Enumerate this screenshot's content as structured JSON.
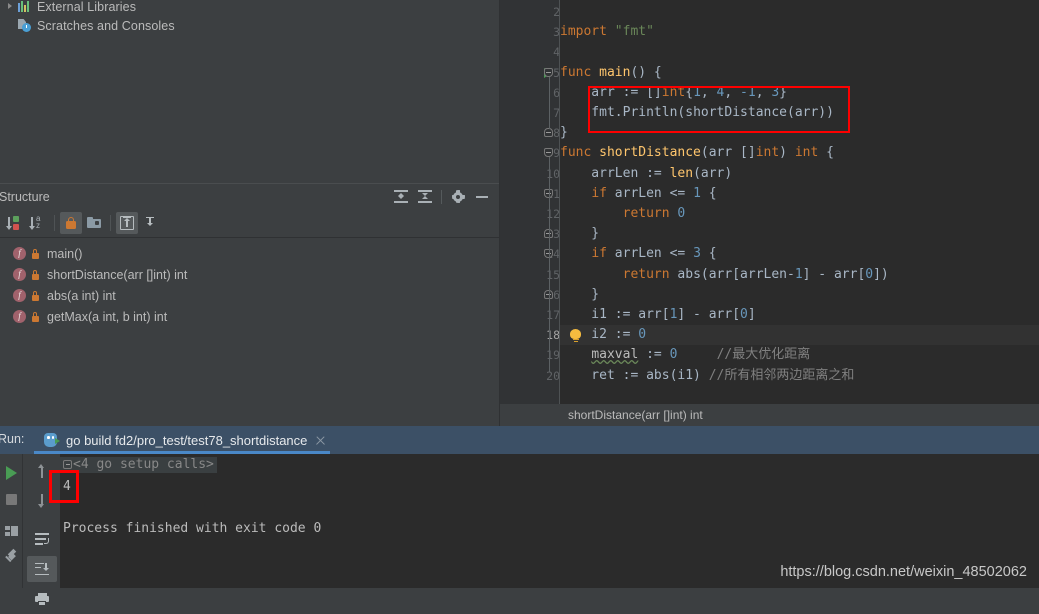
{
  "project_tree": {
    "items": [
      {
        "label": "External Libraries",
        "icon": "library-bars-icon",
        "expandable": true
      },
      {
        "label": "Scratches and Consoles",
        "icon": "scratches-icon",
        "expandable": false
      }
    ]
  },
  "structure": {
    "title": "Structure",
    "header_actions": [
      {
        "name": "expand-all-icon",
        "title": "Expand All"
      },
      {
        "name": "collapse-all-icon",
        "title": "Collapse All"
      },
      {
        "name": "gear-icon",
        "title": "Settings"
      },
      {
        "name": "minimize-icon",
        "title": "Hide"
      }
    ],
    "toolbar": [
      {
        "name": "sort-by-visibility-icon",
        "active": false
      },
      {
        "name": "sort-alphabetically-icon",
        "active": false
      },
      {
        "name": "show-non-public-icon",
        "active": true
      },
      {
        "name": "group-by-folder-icon",
        "active": false
      },
      {
        "name": "scroll-from-source-icon",
        "active": true
      },
      {
        "name": "scroll-to-source-icon",
        "active": false
      }
    ],
    "items": [
      {
        "label": "main()"
      },
      {
        "label": "shortDistance(arr []int) int"
      },
      {
        "label": "abs(a int) int"
      },
      {
        "label": "getMax(a int, b int) int"
      }
    ]
  },
  "editor": {
    "first_visible_line": 2,
    "current_line": 18,
    "run_marker_line": 5,
    "bulb_line": 18,
    "lines": [
      {
        "num": 2,
        "tokens": []
      },
      {
        "num": 3,
        "tokens": [
          {
            "t": "k",
            "v": "import"
          },
          {
            "t": "t",
            "v": " "
          },
          {
            "t": "s",
            "v": "\"fmt\""
          }
        ]
      },
      {
        "num": 4,
        "tokens": []
      },
      {
        "num": 5,
        "tokens": [
          {
            "t": "k",
            "v": "func"
          },
          {
            "t": "t",
            "v": " "
          },
          {
            "t": "f",
            "v": "main"
          },
          {
            "t": "t",
            "v": "() {"
          }
        ]
      },
      {
        "num": 6,
        "tokens": [
          {
            "t": "t",
            "v": "    arr := []"
          },
          {
            "t": "k",
            "v": "int"
          },
          {
            "t": "t",
            "v": "{"
          },
          {
            "t": "n",
            "v": "1"
          },
          {
            "t": "t",
            "v": ", "
          },
          {
            "t": "n",
            "v": "4"
          },
          {
            "t": "t",
            "v": ", "
          },
          {
            "t": "n",
            "v": "-1"
          },
          {
            "t": "t",
            "v": ", "
          },
          {
            "t": "n",
            "v": "3"
          },
          {
            "t": "t",
            "v": "}"
          }
        ]
      },
      {
        "num": 7,
        "tokens": [
          {
            "t": "t",
            "v": "    fmt."
          },
          {
            "t": "fn",
            "v": "Println"
          },
          {
            "t": "t",
            "v": "("
          },
          {
            "t": "fn",
            "v": "shortDistance"
          },
          {
            "t": "t",
            "v": "(arr))"
          }
        ]
      },
      {
        "num": 8,
        "tokens": [
          {
            "t": "t",
            "v": "}"
          }
        ]
      },
      {
        "num": 9,
        "tokens": [
          {
            "t": "k",
            "v": "func"
          },
          {
            "t": "t",
            "v": " "
          },
          {
            "t": "f",
            "v": "shortDistance"
          },
          {
            "t": "t",
            "v": "(arr []"
          },
          {
            "t": "k",
            "v": "int"
          },
          {
            "t": "t",
            "v": ") "
          },
          {
            "t": "k",
            "v": "int"
          },
          {
            "t": "t",
            "v": " {"
          }
        ]
      },
      {
        "num": 10,
        "tokens": [
          {
            "t": "t",
            "v": "    arrLen := "
          },
          {
            "t": "f",
            "v": "len"
          },
          {
            "t": "t",
            "v": "(arr)"
          }
        ]
      },
      {
        "num": 11,
        "tokens": [
          {
            "t": "t",
            "v": "    "
          },
          {
            "t": "k",
            "v": "if"
          },
          {
            "t": "t",
            "v": " arrLen <= "
          },
          {
            "t": "n",
            "v": "1"
          },
          {
            "t": "t",
            "v": " {"
          }
        ]
      },
      {
        "num": 12,
        "tokens": [
          {
            "t": "t",
            "v": "        "
          },
          {
            "t": "k",
            "v": "return"
          },
          {
            "t": "t",
            "v": " "
          },
          {
            "t": "n",
            "v": "0"
          }
        ]
      },
      {
        "num": 13,
        "tokens": [
          {
            "t": "t",
            "v": "    }"
          }
        ]
      },
      {
        "num": 14,
        "tokens": [
          {
            "t": "t",
            "v": "    "
          },
          {
            "t": "k",
            "v": "if"
          },
          {
            "t": "t",
            "v": " arrLen <= "
          },
          {
            "t": "n",
            "v": "3"
          },
          {
            "t": "t",
            "v": " {"
          }
        ]
      },
      {
        "num": 15,
        "tokens": [
          {
            "t": "t",
            "v": "        "
          },
          {
            "t": "k",
            "v": "return"
          },
          {
            "t": "t",
            "v": " "
          },
          {
            "t": "fn",
            "v": "abs"
          },
          {
            "t": "t",
            "v": "(arr[arrLen-"
          },
          {
            "t": "n",
            "v": "1"
          },
          {
            "t": "t",
            "v": "] - arr["
          },
          {
            "t": "n",
            "v": "0"
          },
          {
            "t": "t",
            "v": "])"
          }
        ]
      },
      {
        "num": 16,
        "tokens": [
          {
            "t": "t",
            "v": "    }"
          }
        ]
      },
      {
        "num": 17,
        "tokens": [
          {
            "t": "t",
            "v": "    i1 := arr["
          },
          {
            "t": "n",
            "v": "1"
          },
          {
            "t": "t",
            "v": "] - arr["
          },
          {
            "t": "n",
            "v": "0"
          },
          {
            "t": "t",
            "v": "]"
          }
        ]
      },
      {
        "num": 18,
        "tokens": [
          {
            "t": "t",
            "v": "    i2 := "
          },
          {
            "t": "n",
            "v": "0"
          }
        ]
      },
      {
        "num": 19,
        "tokens": [
          {
            "t": "t",
            "v": "    "
          },
          {
            "t": "err",
            "v": "maxval"
          },
          {
            "t": "t",
            "v": " := "
          },
          {
            "t": "n",
            "v": "0"
          },
          {
            "t": "t",
            "v": "     "
          },
          {
            "t": "c",
            "v": "//最大优化距离"
          }
        ]
      },
      {
        "num": 20,
        "tokens": [
          {
            "t": "t",
            "v": "    ret := "
          },
          {
            "t": "fn",
            "v": "abs"
          },
          {
            "t": "t",
            "v": "(i1) "
          },
          {
            "t": "c",
            "v": "//所有相邻两边距离之和"
          }
        ]
      }
    ],
    "breadcrumb": "shortDistance(arr []int) int"
  },
  "run_panel": {
    "label": "Run:",
    "tab_title": "go build fd2/pro_test/test78_shortdistance",
    "tab_icon": "go-gopher-run-icon",
    "close_icon": "close-icon",
    "left_toolbar": [
      {
        "name": "rerun-icon"
      },
      {
        "name": "stop-icon"
      },
      {
        "name": "layout-settings-icon"
      },
      {
        "name": "pin-tab-icon"
      }
    ],
    "mid_toolbar": [
      {
        "name": "up-arrow-icon",
        "active": false
      },
      {
        "name": "down-arrow-icon",
        "active": false
      },
      {
        "name": "soft-wrap-icon",
        "active": false
      },
      {
        "name": "scroll-to-end-icon",
        "active": true
      },
      {
        "name": "print-icon",
        "active": false
      }
    ],
    "console": {
      "folded_label": "<4 go setup calls>",
      "output": "4",
      "exit_message": "Process finished with exit code 0"
    }
  },
  "annotations": [
    {
      "name": "code-highlight-box",
      "color": "#fe0000"
    },
    {
      "name": "console-output-highlight-box",
      "color": "#fe0000"
    }
  ],
  "watermark": "https://blog.csdn.net/weixin_48502062"
}
